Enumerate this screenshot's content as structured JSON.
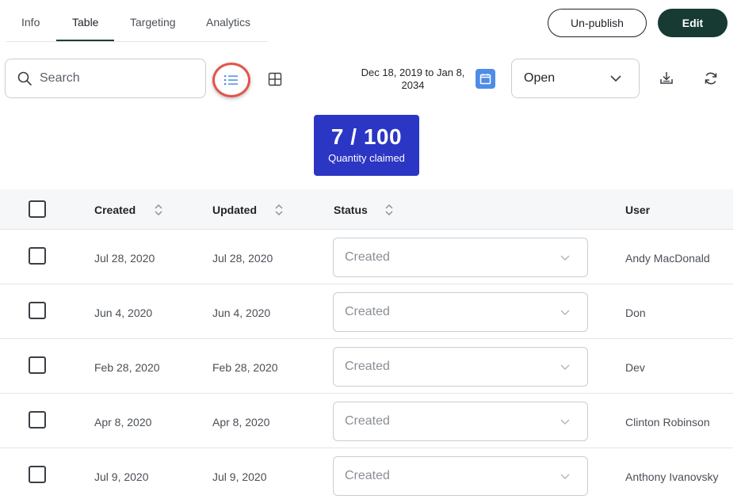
{
  "tabs": [
    {
      "label": "Info"
    },
    {
      "label": "Table"
    },
    {
      "label": "Targeting"
    },
    {
      "label": "Analytics"
    }
  ],
  "active_tab": "Table",
  "header": {
    "unpublish_label": "Un-publish",
    "edit_label": "Edit"
  },
  "toolbar": {
    "search_placeholder": "Search",
    "date_range": "Dec 18, 2019 to Jan 8, 2034",
    "status_filter": "Open"
  },
  "stat": {
    "value": "7 / 100",
    "label": "Quantity claimed"
  },
  "table": {
    "columns": [
      "Created",
      "Updated",
      "Status",
      "User"
    ],
    "rows": [
      {
        "created": "Jul 28, 2020",
        "updated": "Jul 28, 2020",
        "status": "Created",
        "user": "Andy MacDonald"
      },
      {
        "created": "Jun 4, 2020",
        "updated": "Jun 4, 2020",
        "status": "Created",
        "user": "Don"
      },
      {
        "created": "Feb 28, 2020",
        "updated": "Feb 28, 2020",
        "status": "Created",
        "user": "Dev"
      },
      {
        "created": "Apr 8, 2020",
        "updated": "Apr 8, 2020",
        "status": "Created",
        "user": "Clinton Robinson"
      },
      {
        "created": "Jul 9, 2020",
        "updated": "Jul 9, 2020",
        "status": "Created",
        "user": "Anthony Ivanovsky"
      }
    ]
  },
  "colors": {
    "primary_dark": "#173a33",
    "stat_blue": "#2b36c4",
    "calendar_blue": "#4f8be8",
    "highlight_red": "#e2554c"
  },
  "icons": [
    "search-icon",
    "list-view-icon",
    "grid-view-icon",
    "calendar-icon",
    "chevron-down-icon",
    "download-icon",
    "refresh-icon",
    "sort-icon"
  ]
}
